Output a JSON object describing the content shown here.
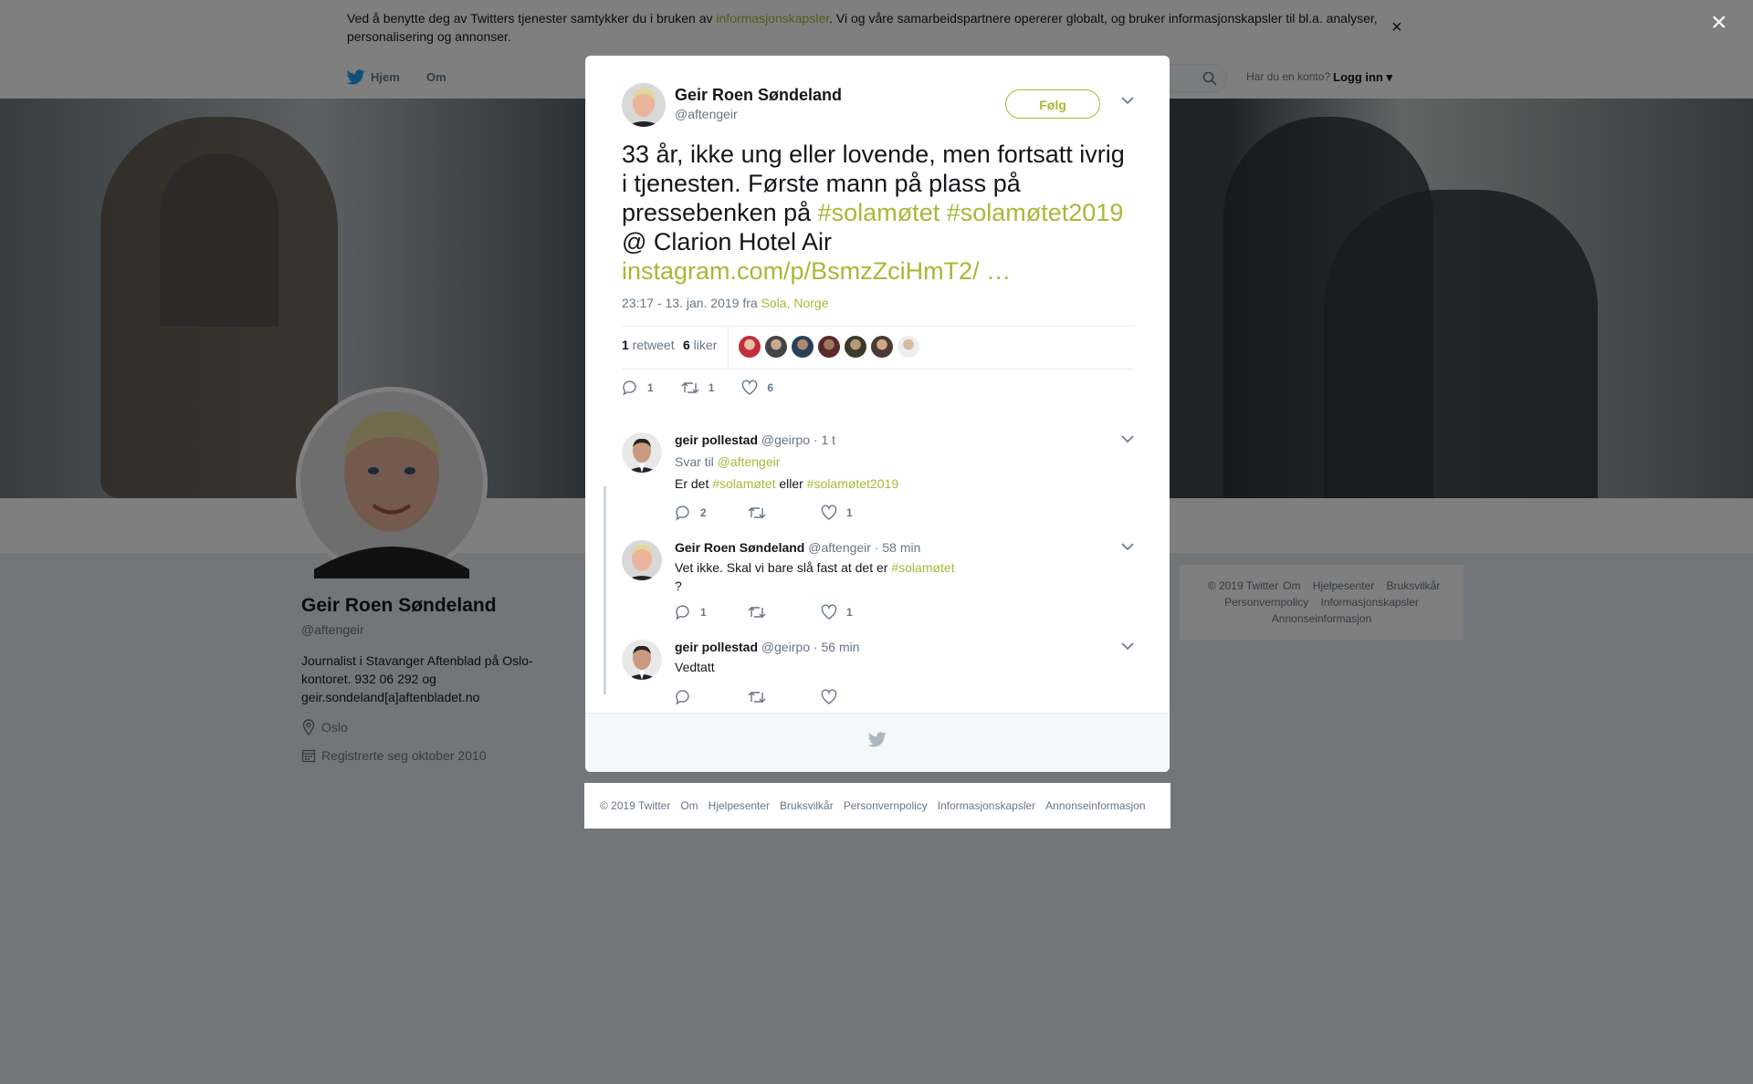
{
  "cookie_bar": {
    "text_before": "Ved å benytte deg av Twitters tjenester samtykker du i bruken av ",
    "link": "informasjonskapsler",
    "text_after": ". Vi og våre samarbeidspartnere opererer globalt, og bruker informasjonskapsler til bl.a. analyser, personalisering og annonser.",
    "close": "×"
  },
  "nav": {
    "home": "Hjem",
    "about": "Om",
    "account_question": "Har du en konto?",
    "login": "Logg inn"
  },
  "profile": {
    "name": "Geir Roen Søndeland",
    "handle": "@aftengeir",
    "bio": "Journalist i Stavanger Aftenblad på Oslo-kontoret. 932 06 292 og geir.sondeland[a]aftenbladet.no",
    "location": "Oslo",
    "joined": "Registrerte seg oktober 2010"
  },
  "side_footer": {
    "links": [
      "© 2019 Twitter",
      "Om",
      "Hjelpesenter",
      "Bruksvilkår",
      "Personvernpolicy",
      "Informasjonskapsler",
      "Annonseinformasjon"
    ]
  },
  "overlay": {
    "close": "×"
  },
  "tweet": {
    "author_name": "Geir Roen Søndeland",
    "author_handle": "@aftengeir",
    "follow": "Følg",
    "text_1": "33 år, ikke ung eller lovende, men fortsatt ivrig i tjenesten. Første mann på plass på pressebenken på ",
    "hashtag_1": "#solamøtet",
    "hashtag_2": "#solamøtet2019",
    "text_2": " @ Clarion Hotel Air",
    "link": " instagram.com/p/BsmzZciHmT2/  …",
    "time": "23:17 - 13. jan. 2019 fra ",
    "location": "Sola, Norge",
    "retweet_count": "1",
    "retweet_label": " retweet",
    "like_count": "6",
    "like_label": " liker",
    "reply_action_count": "1",
    "retweet_action_count": "1",
    "like_action_count": "6"
  },
  "replies": [
    {
      "name": "geir pollestad",
      "handle": "@geirpo",
      "time": " · 1 t",
      "reply_to_label": "Svar til ",
      "reply_to": "@aftengeir",
      "text_1": "Er det ",
      "hashtag_1": "#solamøtet",
      "text_2": " eller ",
      "hashtag_2": "#solamøtet2019",
      "replies": "2",
      "retweets": "",
      "likes": "1"
    },
    {
      "name": "Geir Roen Søndeland",
      "handle": "@aftengeir",
      "time": " · 58 min",
      "text_1": "Vet ikke. Skal vi bare slå fast at det er ",
      "hashtag_1": "#solamøtet",
      "text_2": "?",
      "replies": "1",
      "retweets": "",
      "likes": "1"
    },
    {
      "name": "geir pollestad",
      "handle": "@geirpo",
      "time": " · 56 min",
      "text_1": "Vedtatt",
      "replies": "",
      "retweets": "",
      "likes": ""
    }
  ],
  "bottom_footer": {
    "links": [
      "© 2019 Twitter",
      "Om",
      "Hjelpesenter",
      "Bruksvilkår",
      "Personvernpolicy",
      "Informasjonskapsler",
      "Annonseinformasjon"
    ]
  },
  "colors": {
    "accent": "#a8b836",
    "overlay": "rgba(0,0,0,0.5)",
    "muted_text": "#657786"
  },
  "icons": [
    "twitter-bird-icon",
    "search-icon",
    "location-pin-icon",
    "calendar-icon",
    "caret-down-icon",
    "reply-icon",
    "retweet-icon",
    "like-icon",
    "close-icon"
  ]
}
